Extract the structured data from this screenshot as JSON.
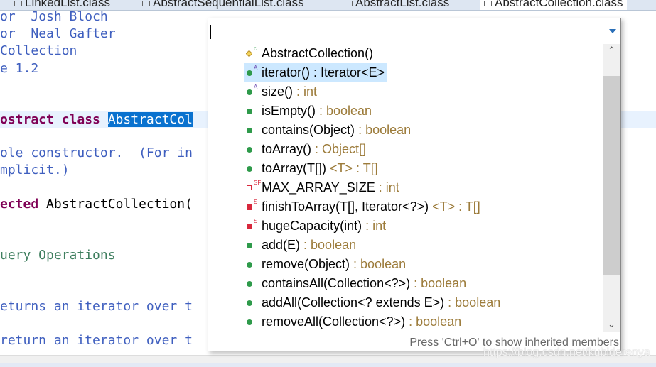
{
  "tabs": [
    {
      "label": "LinkedList.class",
      "active": false
    },
    {
      "label": "AbstractSequentialList.class",
      "active": false
    },
    {
      "label": "AbstractList.class",
      "active": false
    },
    {
      "label": "AbstractCollection.class",
      "active": true
    }
  ],
  "code": {
    "l1a": "or  ",
    "l1b": "Josh Bloch",
    "l2a": "or  ",
    "l2b": "Neal Gafter",
    "l3": "Collection",
    "l4": "e 1.2",
    "l5a": "ostract class ",
    "l5b": "AbstractCol",
    "l6": "ole constructor.  (For in",
    "l7": "mplicit.)",
    "l8a": "ected ",
    "l8b": "AbstractCollection(",
    "l9": "uery Operations",
    "l10": "eturns an iterator over t",
    "l11": "return an iterator over t"
  },
  "popup": {
    "filter_value": "",
    "items": [
      {
        "icon": "constructor-icon",
        "mod": "c",
        "name": "AbstractCollection()",
        "ret": ""
      },
      {
        "icon": "public-method-icon",
        "mod": "A",
        "name": "iterator() : Iterator<E>",
        "ret": "",
        "selected": true
      },
      {
        "icon": "public-method-icon",
        "mod": "A",
        "name": "size()",
        "ret": " : int"
      },
      {
        "icon": "public-method-icon",
        "mod": "",
        "name": "isEmpty()",
        "ret": " : boolean"
      },
      {
        "icon": "public-method-icon",
        "mod": "",
        "name": "contains(Object)",
        "ret": " : boolean"
      },
      {
        "icon": "public-method-icon",
        "mod": "",
        "name": "toArray()",
        "ret": " : Object[]"
      },
      {
        "icon": "public-method-icon",
        "mod": "",
        "name": "toArray(T[])",
        "ret": " <T> : T[]"
      },
      {
        "icon": "private-field-icon",
        "mod": "SF",
        "name": "MAX_ARRAY_SIZE",
        "ret": " : int"
      },
      {
        "icon": "private-method-icon",
        "mod": "S",
        "name": "finishToArray(T[], Iterator<?>)",
        "ret": " <T> : T[]"
      },
      {
        "icon": "private-method-icon",
        "mod": "S",
        "name": "hugeCapacity(int)",
        "ret": " : int"
      },
      {
        "icon": "public-method-icon",
        "mod": "",
        "name": "add(E)",
        "ret": " : boolean"
      },
      {
        "icon": "public-method-icon",
        "mod": "",
        "name": "remove(Object)",
        "ret": " : boolean"
      },
      {
        "icon": "public-method-icon",
        "mod": "",
        "name": "containsAll(Collection<?>)",
        "ret": " : boolean"
      },
      {
        "icon": "public-method-icon",
        "mod": "",
        "name": "addAll(Collection<? extends E>)",
        "ret": " : boolean"
      },
      {
        "icon": "public-method-icon",
        "mod": "",
        "name": "removeAll(Collection<?>)",
        "ret": " : boolean"
      }
    ],
    "footer": "Press 'Ctrl+O' to show inherited members"
  },
  "watermark": "https://blog.csdn.net/kubiderenya"
}
